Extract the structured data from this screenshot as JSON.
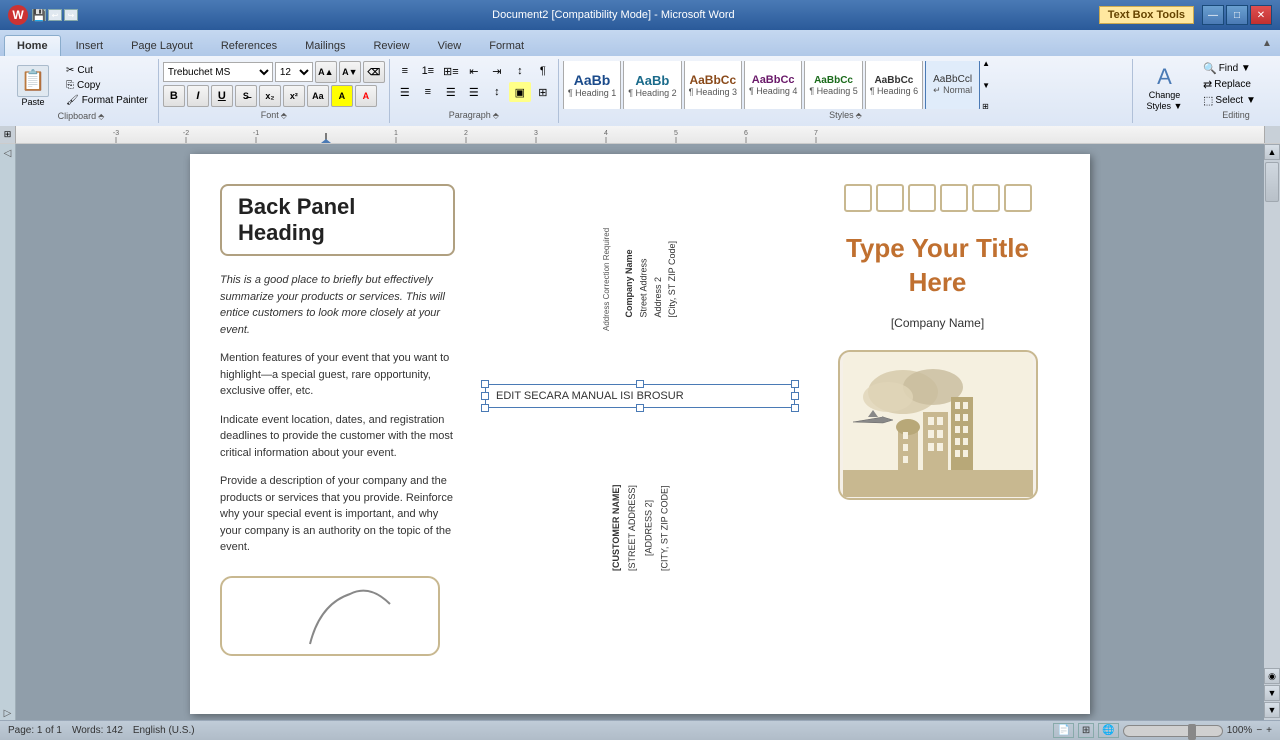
{
  "titlebar": {
    "title": "Document2 [Compatibility Mode] - Microsoft Word",
    "textbox_tools": "Text Box Tools",
    "min": "—",
    "max": "□",
    "close": "✕"
  },
  "ribbon": {
    "tabs": [
      "Home",
      "Insert",
      "Page Layout",
      "References",
      "Mailings",
      "Review",
      "View",
      "Format"
    ],
    "active_tab": "Home",
    "textbox_tab": "Text Box Tools",
    "clipboard": {
      "paste": "Paste",
      "cut": "Cut",
      "copy": "Copy",
      "format_painter": "Format Painter",
      "group_label": "Clipboard"
    },
    "font": {
      "font_name": "Trebuchet MS",
      "font_size": "12",
      "bold": "B",
      "italic": "I",
      "underline": "U",
      "strikethrough": "S",
      "subscript": "x₂",
      "superscript": "x²",
      "group_label": "Font"
    },
    "paragraph": {
      "group_label": "Paragraph"
    },
    "styles": {
      "heading1": "Heading 1",
      "heading2": "Heading 2",
      "heading3": "Heading 3",
      "heading4": "Heading 4",
      "heading5": "Heading 5",
      "heading6": "Heading 6",
      "normal": "↵ Normal",
      "change_styles": "Change\nStyles",
      "group_label": "Styles"
    },
    "editing": {
      "find": "Find",
      "replace": "Replace",
      "select": "Select",
      "group_label": "Editing"
    }
  },
  "document": {
    "left_column": {
      "heading": "Back Panel Heading",
      "italic_text": "This is a good place to briefly but effectively summarize your products or services. This will entice customers to look more closely at your event.",
      "para2": "Mention features of your event that you want to highlight—a special guest, rare opportunity, exclusive offer, etc.",
      "para3": "Indicate event location, dates, and registration deadlines to provide the customer with the most critical information about your event.",
      "para4": "Provide a description of your company and the products or services that you provide. Reinforce why your special event is important, and why your company is an authority on the topic of the event."
    },
    "middle_column": {
      "address_correction": "Address Correction Required",
      "company_name_label": "Company Name",
      "street_address": "Street Address",
      "address2": "Address 2",
      "city_state_zip": "[City, ST  ZIP Code]",
      "textbox_content": "EDIT SECARA MANUAL ISI BROSUR",
      "customer_name": "[CUSTOMER NAME]",
      "street_address2": "[STREET ADDRESS]",
      "address2_2": "[ADDRESS 2]",
      "city_state_zip2": "[CITY, ST  ZIP CODE]"
    },
    "right_column": {
      "title_line1": "Type Your Title",
      "title_line2": "Here",
      "company_name": "[Company Name]"
    }
  }
}
